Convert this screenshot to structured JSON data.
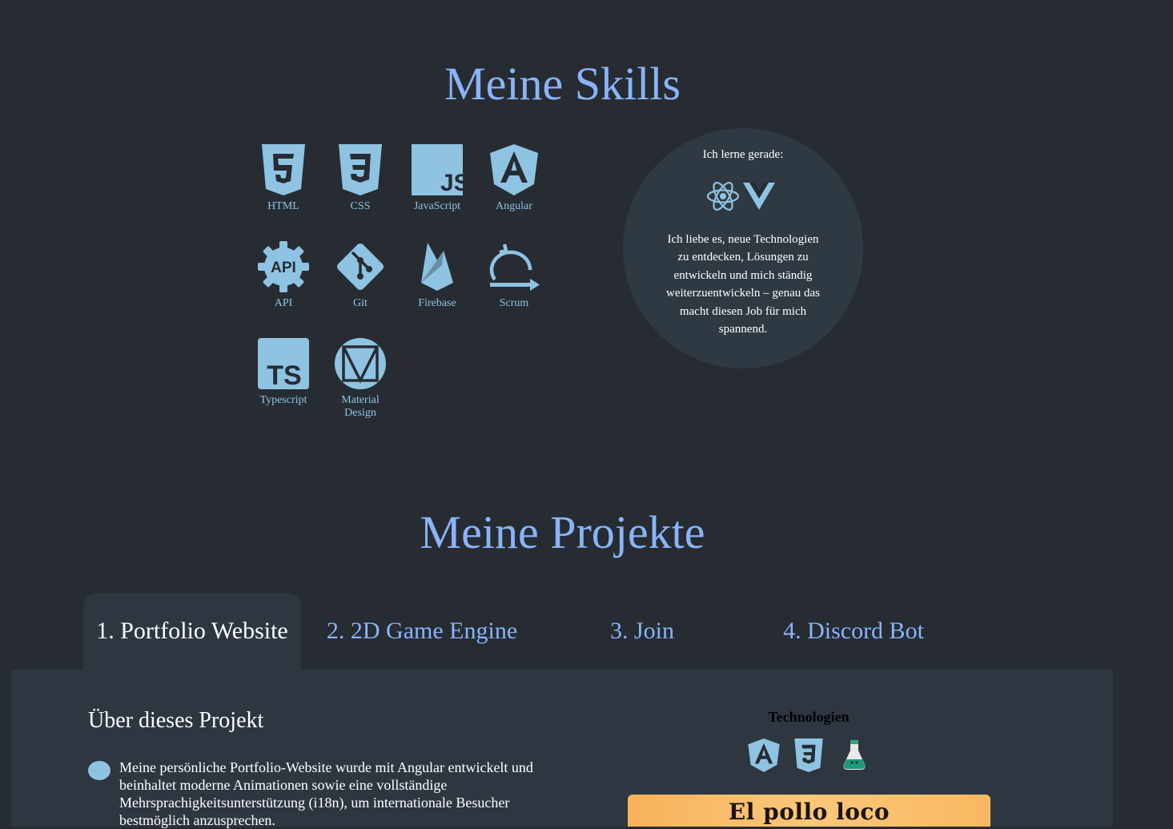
{
  "skills_section": {
    "title": "Meine Skills",
    "skills": [
      {
        "label": "HTML",
        "icon": "html5-icon"
      },
      {
        "label": "CSS",
        "icon": "css3-icon"
      },
      {
        "label": "JavaScript",
        "icon": "javascript-icon"
      },
      {
        "label": "Angular",
        "icon": "angular-icon"
      },
      {
        "label": "API",
        "icon": "api-icon"
      },
      {
        "label": "Git",
        "icon": "git-icon"
      },
      {
        "label": "Firebase",
        "icon": "firebase-icon"
      },
      {
        "label": "Scrum",
        "icon": "scrum-icon"
      },
      {
        "label": "Typescript",
        "icon": "typescript-icon"
      },
      {
        "label": "Material Design",
        "icon": "material-design-icon"
      }
    ],
    "learning": {
      "title": "Ich lerne gerade:",
      "icons": [
        "react-icon",
        "vue-icon"
      ],
      "text": "Ich liebe es, neue Technologien zu entdecken, Lösungen zu entwickeln und mich ständig weiterzuentwickeln – genau das macht diesen Job für mich spannend."
    }
  },
  "projects_section": {
    "title": "Meine Projekte",
    "tabs": [
      {
        "label": "1. Portfolio Website",
        "active": true
      },
      {
        "label": "2. 2D Game Engine",
        "active": false
      },
      {
        "label": "3. Join",
        "active": false
      },
      {
        "label": "4. Discord Bot",
        "active": false
      }
    ],
    "panel": {
      "about_heading": "Über dieses Projekt",
      "description": "Meine persönliche Portfolio-Website wurde mit Angular entwickelt und beinhaltet moderne Animationen sowie eine vollständige Mehrsprachigkeitsunterstützung (i18n), um internationale Besucher bestmöglich anzusprechen.",
      "tech_heading": "Technologien",
      "tech_icons": [
        "angular-icon",
        "css3-icon",
        "potion-flask-icon"
      ],
      "preview_title": "El pollo loco"
    }
  },
  "colors": {
    "background": "#272c33",
    "panel": "#2e3740",
    "accent": "#8ab4f8",
    "icon": "#8fc3e2"
  }
}
